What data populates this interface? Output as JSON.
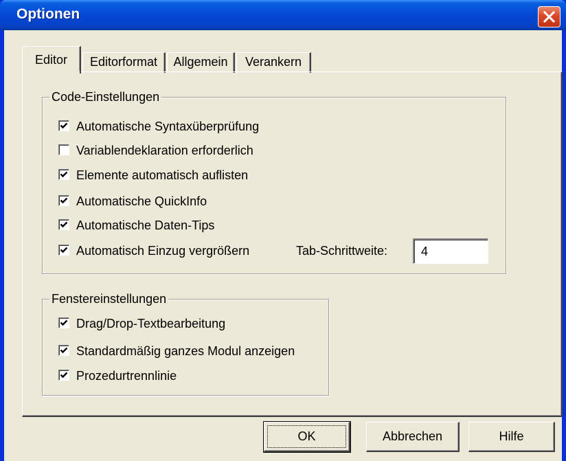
{
  "window": {
    "title": "Optionen"
  },
  "tabs": [
    {
      "label": "Editor",
      "active": true
    },
    {
      "label": "Editorformat",
      "active": false
    },
    {
      "label": "Allgemein",
      "active": false
    },
    {
      "label": "Verankern",
      "active": false
    }
  ],
  "code_settings": {
    "legend": "Code-Einstellungen",
    "options": [
      {
        "label": "Automatische Syntaxüberprüfung",
        "checked": true
      },
      {
        "label": "Variablendeklaration erforderlich",
        "checked": false
      },
      {
        "label": "Elemente automatisch auflisten",
        "checked": true
      },
      {
        "label": "Automatische QuickInfo",
        "checked": true
      },
      {
        "label": "Automatische Daten-Tips",
        "checked": true
      },
      {
        "label": "Automatisch Einzug vergrößern",
        "checked": true
      }
    ],
    "tab_width_label": "Tab-Schrittweite:",
    "tab_width_value": "4"
  },
  "window_settings": {
    "legend": "Fenstereinstellungen",
    "options": [
      {
        "label": "Drag/Drop-Textbearbeitung",
        "checked": true
      },
      {
        "label": "Standardmäßig ganzes Modul anzeigen",
        "checked": true
      },
      {
        "label": "Prozedurtrennlinie",
        "checked": true
      }
    ]
  },
  "buttons": {
    "ok": "OK",
    "cancel": "Abbrechen",
    "help": "Hilfe"
  },
  "colors": {
    "titlebar": "#0348d3",
    "close": "#d8482a",
    "face": "#ece9d8"
  }
}
